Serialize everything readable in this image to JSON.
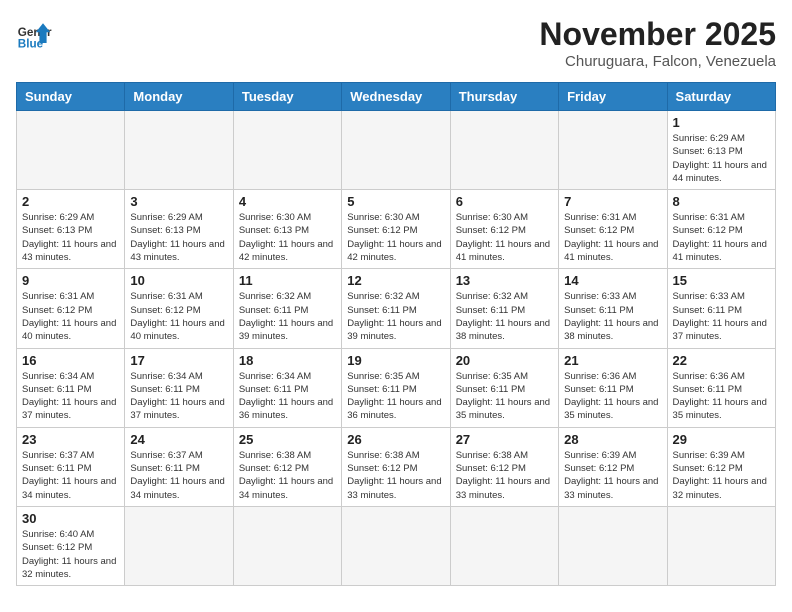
{
  "header": {
    "logo_general": "General",
    "logo_blue": "Blue",
    "month_title": "November 2025",
    "subtitle": "Churuguara, Falcon, Venezuela"
  },
  "days_of_week": [
    "Sunday",
    "Monday",
    "Tuesday",
    "Wednesday",
    "Thursday",
    "Friday",
    "Saturday"
  ],
  "weeks": [
    [
      {
        "day": "",
        "info": ""
      },
      {
        "day": "",
        "info": ""
      },
      {
        "day": "",
        "info": ""
      },
      {
        "day": "",
        "info": ""
      },
      {
        "day": "",
        "info": ""
      },
      {
        "day": "",
        "info": ""
      },
      {
        "day": "1",
        "info": "Sunrise: 6:29 AM\nSunset: 6:13 PM\nDaylight: 11 hours and 44 minutes."
      }
    ],
    [
      {
        "day": "2",
        "info": "Sunrise: 6:29 AM\nSunset: 6:13 PM\nDaylight: 11 hours and 43 minutes."
      },
      {
        "day": "3",
        "info": "Sunrise: 6:29 AM\nSunset: 6:13 PM\nDaylight: 11 hours and 43 minutes."
      },
      {
        "day": "4",
        "info": "Sunrise: 6:30 AM\nSunset: 6:13 PM\nDaylight: 11 hours and 42 minutes."
      },
      {
        "day": "5",
        "info": "Sunrise: 6:30 AM\nSunset: 6:12 PM\nDaylight: 11 hours and 42 minutes."
      },
      {
        "day": "6",
        "info": "Sunrise: 6:30 AM\nSunset: 6:12 PM\nDaylight: 11 hours and 41 minutes."
      },
      {
        "day": "7",
        "info": "Sunrise: 6:31 AM\nSunset: 6:12 PM\nDaylight: 11 hours and 41 minutes."
      },
      {
        "day": "8",
        "info": "Sunrise: 6:31 AM\nSunset: 6:12 PM\nDaylight: 11 hours and 41 minutes."
      }
    ],
    [
      {
        "day": "9",
        "info": "Sunrise: 6:31 AM\nSunset: 6:12 PM\nDaylight: 11 hours and 40 minutes."
      },
      {
        "day": "10",
        "info": "Sunrise: 6:31 AM\nSunset: 6:12 PM\nDaylight: 11 hours and 40 minutes."
      },
      {
        "day": "11",
        "info": "Sunrise: 6:32 AM\nSunset: 6:11 PM\nDaylight: 11 hours and 39 minutes."
      },
      {
        "day": "12",
        "info": "Sunrise: 6:32 AM\nSunset: 6:11 PM\nDaylight: 11 hours and 39 minutes."
      },
      {
        "day": "13",
        "info": "Sunrise: 6:32 AM\nSunset: 6:11 PM\nDaylight: 11 hours and 38 minutes."
      },
      {
        "day": "14",
        "info": "Sunrise: 6:33 AM\nSunset: 6:11 PM\nDaylight: 11 hours and 38 minutes."
      },
      {
        "day": "15",
        "info": "Sunrise: 6:33 AM\nSunset: 6:11 PM\nDaylight: 11 hours and 37 minutes."
      }
    ],
    [
      {
        "day": "16",
        "info": "Sunrise: 6:34 AM\nSunset: 6:11 PM\nDaylight: 11 hours and 37 minutes."
      },
      {
        "day": "17",
        "info": "Sunrise: 6:34 AM\nSunset: 6:11 PM\nDaylight: 11 hours and 37 minutes."
      },
      {
        "day": "18",
        "info": "Sunrise: 6:34 AM\nSunset: 6:11 PM\nDaylight: 11 hours and 36 minutes."
      },
      {
        "day": "19",
        "info": "Sunrise: 6:35 AM\nSunset: 6:11 PM\nDaylight: 11 hours and 36 minutes."
      },
      {
        "day": "20",
        "info": "Sunrise: 6:35 AM\nSunset: 6:11 PM\nDaylight: 11 hours and 35 minutes."
      },
      {
        "day": "21",
        "info": "Sunrise: 6:36 AM\nSunset: 6:11 PM\nDaylight: 11 hours and 35 minutes."
      },
      {
        "day": "22",
        "info": "Sunrise: 6:36 AM\nSunset: 6:11 PM\nDaylight: 11 hours and 35 minutes."
      }
    ],
    [
      {
        "day": "23",
        "info": "Sunrise: 6:37 AM\nSunset: 6:11 PM\nDaylight: 11 hours and 34 minutes."
      },
      {
        "day": "24",
        "info": "Sunrise: 6:37 AM\nSunset: 6:11 PM\nDaylight: 11 hours and 34 minutes."
      },
      {
        "day": "25",
        "info": "Sunrise: 6:38 AM\nSunset: 6:12 PM\nDaylight: 11 hours and 34 minutes."
      },
      {
        "day": "26",
        "info": "Sunrise: 6:38 AM\nSunset: 6:12 PM\nDaylight: 11 hours and 33 minutes."
      },
      {
        "day": "27",
        "info": "Sunrise: 6:38 AM\nSunset: 6:12 PM\nDaylight: 11 hours and 33 minutes."
      },
      {
        "day": "28",
        "info": "Sunrise: 6:39 AM\nSunset: 6:12 PM\nDaylight: 11 hours and 33 minutes."
      },
      {
        "day": "29",
        "info": "Sunrise: 6:39 AM\nSunset: 6:12 PM\nDaylight: 11 hours and 32 minutes."
      }
    ],
    [
      {
        "day": "30",
        "info": "Sunrise: 6:40 AM\nSunset: 6:12 PM\nDaylight: 11 hours and 32 minutes."
      },
      {
        "day": "",
        "info": ""
      },
      {
        "day": "",
        "info": ""
      },
      {
        "day": "",
        "info": ""
      },
      {
        "day": "",
        "info": ""
      },
      {
        "day": "",
        "info": ""
      },
      {
        "day": "",
        "info": ""
      }
    ]
  ]
}
